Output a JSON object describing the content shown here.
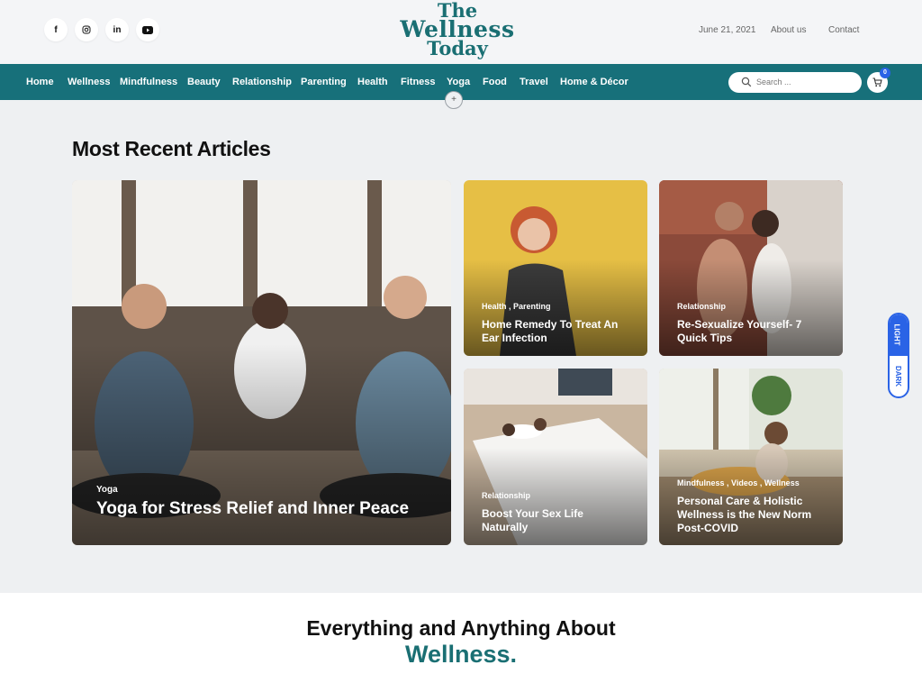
{
  "social": [
    "f",
    "ig",
    "in",
    "yt"
  ],
  "logo": {
    "line1": "The",
    "line2": "Wellness",
    "line3": "Today"
  },
  "toplinks": {
    "date": "June 21, 2021",
    "about": "About us",
    "contact": "Contact"
  },
  "nav": [
    "Home",
    "Wellness",
    "Mindfulness",
    "Beauty",
    "Relationship",
    "Parenting",
    "Health",
    "Fitness",
    "Yoga",
    "Food",
    "Travel",
    "Home & Décor"
  ],
  "search": {
    "placeholder": "Search ..."
  },
  "cart": {
    "count": "0"
  },
  "nav_plus": "+",
  "section_title": "Most Recent Articles",
  "articles": [
    {
      "cats": "Yoga",
      "title": "Yoga for Stress Relief and Inner Peace"
    },
    {
      "cats": "Health , Parenting",
      "title": "Home Remedy To Treat An Ear Infection"
    },
    {
      "cats": "Relationship",
      "title": "Re-Sexualize Yourself- 7 Quick Tips"
    },
    {
      "cats": "Relationship",
      "title": "Boost Your Sex Life Naturally"
    },
    {
      "cats": "Mindfulness , Videos , Wellness",
      "title": "Personal Care & Holistic Wellness is the New Norm Post-COVID"
    }
  ],
  "theme_toggle": {
    "light": "LIGHT",
    "dark": "DARK"
  },
  "tagline": {
    "line1": "Everything and Anything About",
    "line2": "Wellness."
  },
  "colors": {
    "brand": "#17707a",
    "accent": "#2a63e6"
  }
}
